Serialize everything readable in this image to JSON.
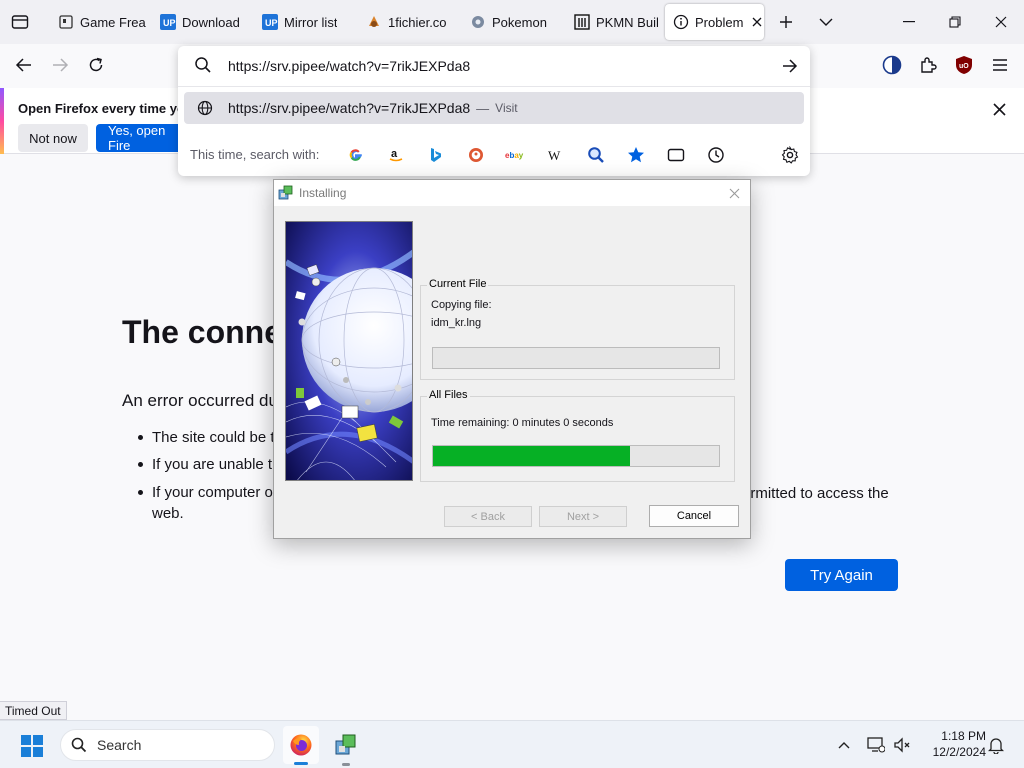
{
  "browser": {
    "tabs": [
      {
        "title": "Game Frea",
        "icon": "bookmark-page-icon"
      },
      {
        "title": "Download",
        "icon": "up-logo-icon"
      },
      {
        "title": "Mirror list",
        "icon": "up-logo-icon"
      },
      {
        "title": "1fichier.co",
        "icon": "fichier-logo-icon"
      },
      {
        "title": "Pokemon",
        "icon": "pokemon-site-icon"
      },
      {
        "title": "PKMN Buil",
        "icon": "building-icon"
      },
      {
        "title": "Problem",
        "icon": "info-icon",
        "active": true
      }
    ],
    "url": "https://srv.pipee/watch?v=7rikJEXPda8"
  },
  "notification": {
    "message": "Open Firefox every time you",
    "not_now": "Not now",
    "yes_open": "Yes, open Fire"
  },
  "urlbar_dropdown": {
    "suggestion_url": "https://srv.pipee/watch?v=7rikJEXPda8",
    "suggestion_sep": "—",
    "suggestion_action": "Visit",
    "search_with_label": "This time, search with:",
    "engines": [
      "google-icon",
      "amazon-icon",
      "bing-icon",
      "duckduckgo-icon",
      "ebay-icon",
      "wikipedia-icon",
      "search-engine-icon",
      "bookmarks-star-icon",
      "tabs-icon",
      "history-icon"
    ]
  },
  "error_page": {
    "title": "The conne",
    "intro": "An error occurred du",
    "bullet1": "The site could be t",
    "bullet2": "If you are unable t",
    "bullet3_start": "If your computer o",
    "bullet3_end": "ermitted to access the",
    "bullet3_cont": "web.",
    "try_again": "Try Again"
  },
  "status_text": "Timed Out",
  "installer": {
    "title": "Installing",
    "current_file_label": "Current File",
    "copying_label": "Copying file:",
    "file_name": "idm_kr.lng",
    "current_progress": 0,
    "all_files_label": "All Files",
    "time_remaining": "Time remaining: 0 minutes 0 seconds",
    "all_progress": 0.69,
    "back": "< Back",
    "next": "Next >",
    "cancel": "Cancel"
  },
  "taskbar": {
    "search_placeholder": "Search",
    "time": "1:18 PM",
    "date": "12/2/2024"
  },
  "colors": {
    "accent_blue": "#0061e0",
    "progress_green": "#06b025"
  }
}
